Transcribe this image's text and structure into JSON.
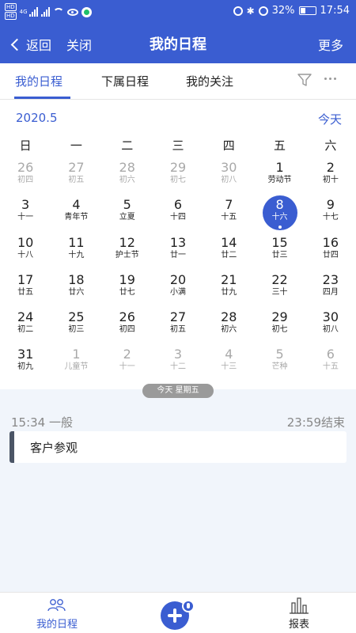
{
  "status_bar": {
    "network": "4G",
    "battery": "32%",
    "time": "17:54"
  },
  "nav": {
    "back": "返回",
    "close": "关闭",
    "title": "我的日程",
    "more": "更多"
  },
  "tabs": [
    {
      "label": "我的日程",
      "active": true
    },
    {
      "label": "下属日程",
      "active": false
    },
    {
      "label": "我的关注",
      "active": false
    }
  ],
  "calendar": {
    "month": "2020.5",
    "today_label": "今天",
    "weekdays": [
      "日",
      "一",
      "二",
      "三",
      "四",
      "五",
      "六"
    ],
    "days": [
      {
        "n": "26",
        "l": "初四",
        "muted": true
      },
      {
        "n": "27",
        "l": "初五",
        "muted": true
      },
      {
        "n": "28",
        "l": "初六",
        "muted": true
      },
      {
        "n": "29",
        "l": "初七",
        "muted": true
      },
      {
        "n": "30",
        "l": "初八",
        "muted": true
      },
      {
        "n": "1",
        "l": "劳动节"
      },
      {
        "n": "2",
        "l": "初十"
      },
      {
        "n": "3",
        "l": "十一"
      },
      {
        "n": "4",
        "l": "青年节"
      },
      {
        "n": "5",
        "l": "立夏"
      },
      {
        "n": "6",
        "l": "十四"
      },
      {
        "n": "7",
        "l": "十五"
      },
      {
        "n": "8",
        "l": "十六",
        "selected": true
      },
      {
        "n": "9",
        "l": "十七"
      },
      {
        "n": "10",
        "l": "十八"
      },
      {
        "n": "11",
        "l": "十九"
      },
      {
        "n": "12",
        "l": "护士节"
      },
      {
        "n": "13",
        "l": "廿一"
      },
      {
        "n": "14",
        "l": "廿二"
      },
      {
        "n": "15",
        "l": "廿三"
      },
      {
        "n": "16",
        "l": "廿四"
      },
      {
        "n": "17",
        "l": "廿五"
      },
      {
        "n": "18",
        "l": "廿六"
      },
      {
        "n": "19",
        "l": "廿七"
      },
      {
        "n": "20",
        "l": "小满"
      },
      {
        "n": "21",
        "l": "廿九"
      },
      {
        "n": "22",
        "l": "三十"
      },
      {
        "n": "23",
        "l": "四月"
      },
      {
        "n": "24",
        "l": "初二"
      },
      {
        "n": "25",
        "l": "初三"
      },
      {
        "n": "26",
        "l": "初四"
      },
      {
        "n": "27",
        "l": "初五"
      },
      {
        "n": "28",
        "l": "初六"
      },
      {
        "n": "29",
        "l": "初七"
      },
      {
        "n": "30",
        "l": "初八"
      },
      {
        "n": "31",
        "l": "初九"
      },
      {
        "n": "1",
        "l": "儿童节",
        "muted": true
      },
      {
        "n": "2",
        "l": "十一",
        "muted": true
      },
      {
        "n": "3",
        "l": "十二",
        "muted": true
      },
      {
        "n": "4",
        "l": "十三",
        "muted": true
      },
      {
        "n": "5",
        "l": "芒种",
        "muted": true
      },
      {
        "n": "6",
        "l": "十五",
        "muted": true
      }
    ],
    "today_pill": "今天 星期五"
  },
  "event": {
    "start": "15:34 一般",
    "end": "23:59结束",
    "title": "客户参观"
  },
  "bottom_nav": {
    "schedule": "我的日程",
    "report": "报表"
  },
  "colors": {
    "primary": "#3a5dd1",
    "panel_bg": "#f1f5fb",
    "muted_text": "#a9a9a9"
  }
}
